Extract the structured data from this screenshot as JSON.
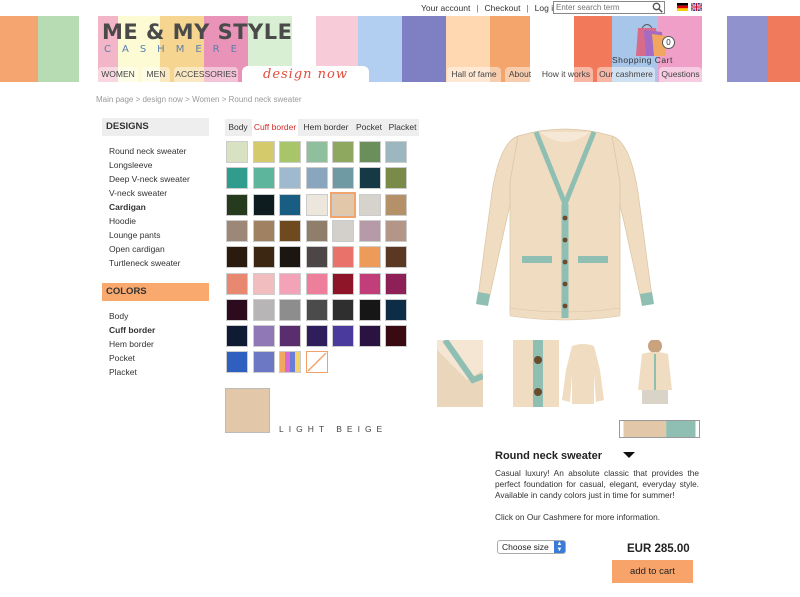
{
  "brand": {
    "logo_main": "ME & MY STYLE",
    "logo_sub": "CASHMERE",
    "stripe_colors": [
      "#f5a570",
      "#b7dbb2",
      "#f3b6c8",
      "#fdfbd4",
      "#f5d58f",
      "#ea93b8",
      "#d9efd3",
      "#ffffff",
      "#f7cbd8",
      "#b2cef0",
      "#7f80c4",
      "#ffd8b2",
      "#f3a56c",
      "#ffffff",
      "#d6c2e9",
      "#fcd58c",
      "#f27a5a",
      "#a8c6ea",
      "#f0a0c8",
      "#dceccc",
      "#ffffff",
      "#8f92cc",
      "#f07a5c"
    ]
  },
  "top_links": {
    "your_account": "Your account",
    "checkout": "Checkout",
    "login": "Log in",
    "sep": "|"
  },
  "search": {
    "placeholder": "Enter search term"
  },
  "cart": {
    "label": "Shopping Cart",
    "count": "0"
  },
  "nav": {
    "left": [
      "WOMEN",
      "MEN",
      "ACCESSORIES"
    ],
    "design_now": "design now",
    "right": [
      "Hall of fame",
      "About",
      "How it works",
      "Our cashmere",
      "Questions"
    ]
  },
  "breadcrumb": "Main page > design now > Women > Round neck sweater",
  "sidebar": {
    "designs_title": "DESIGNS",
    "designs": [
      "Round neck sweater",
      "Longsleeve",
      "Deep V-neck sweater",
      "V-neck sweater",
      "Cardigan",
      "Hoodie",
      "Lounge pants",
      "Open cardigan",
      "Turtleneck sweater"
    ],
    "active_design": "Cardigan",
    "colors_title": "COLORS",
    "parts": [
      "Body",
      "Cuff border",
      "Hem border",
      "Pocket",
      "Placket"
    ],
    "active_part": "Cuff border",
    "designs_head_color": "#eeeeee",
    "colors_head_color": "#f9a96e"
  },
  "tabs": [
    "Body",
    "Cuff border",
    "Hem border",
    "Pocket",
    "Placket"
  ],
  "swatches": [
    "#d8e2c2",
    "#d4c96b",
    "#a9c56a",
    "#90bf9e",
    "#8fa860",
    "#6b8f5b",
    "#9cb7c0",
    "#2f9c8e",
    "#5db59c",
    "#9fb9cf",
    "#8aa6bf",
    "#6f9aa3",
    "#153a45",
    "#7a8a48",
    "#263a1d",
    "#0e1c20",
    "#1a5d83",
    "#ece6dc",
    "#e2c8a8",
    "#d6d2cc",
    "#b5916a",
    "#9d8777",
    "#a08161",
    "#6f4a1e",
    "#8f7f6a",
    "#d3cfcb",
    "#b69aa7",
    "#b39688",
    "#2b1a0e",
    "#3c2712",
    "#1c1610",
    "#4d4646",
    "#e9736a",
    "#ee9a58",
    "#5a3822",
    "#e98870",
    "#f1bdbe",
    "#f3a2b8",
    "#ee7f9b",
    "#8e1528",
    "#c13e7a",
    "#8d2157",
    "#2c0b1e",
    "#b7b5b5",
    "#8d8d8d",
    "#4b4b4b",
    "#2f2f2f",
    "#161616",
    "#0c2d45",
    "#0f1a33",
    "#8f78b5",
    "#5a2e6e",
    "#2e1f5c",
    "#4a3a9e",
    "#2a1340",
    "#3a0a12",
    "#2f5fbf",
    "#6c78c4",
    "stripes",
    "none"
  ],
  "selected_color": {
    "name": "LIGHT BEIGE",
    "hex": "#e2c8a8"
  },
  "product": {
    "name": "Round neck sweater",
    "description": "Casual luxury! An absolute classic that provides the perfect foundation for casual, elegant, everyday style. Available in candy colors just in time for summer!",
    "more_info": "Click on Our Cashmere for more information.",
    "size_label": "Choose size",
    "price": "EUR 285.00",
    "add_to_cart": "add to cart"
  },
  "colors": {
    "body": "#efdcc1",
    "trim": "#8fbfb3",
    "accent": "#f7a36a",
    "active_tab": "#d62a2a"
  }
}
